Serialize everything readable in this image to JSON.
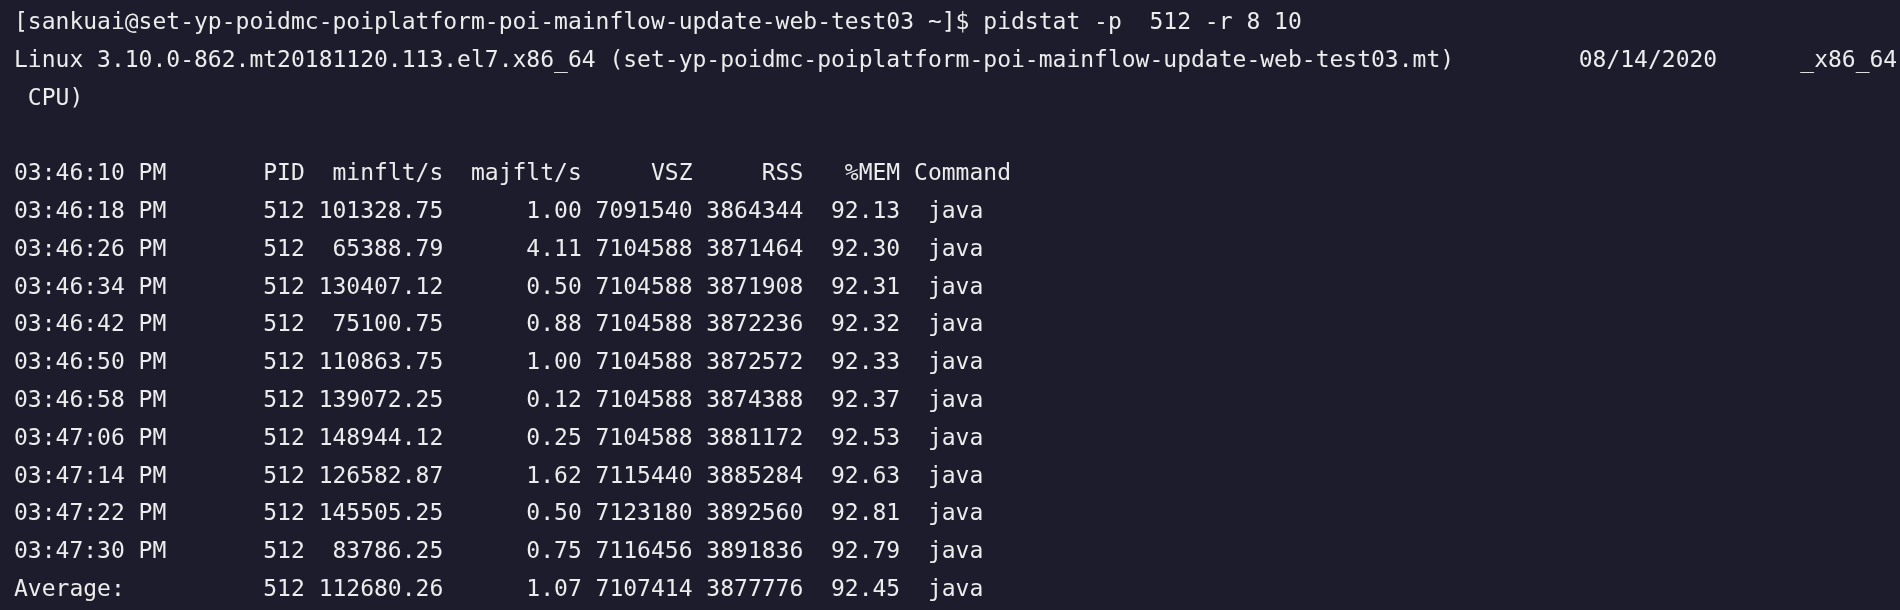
{
  "terminal": {
    "prompt": "[sankuai@set-yp-poidmc-poiplatform-poi-mainflow-update-web-test03 ~]$ pidstat -p  512 -r 8 10",
    "info_lines": [
      "Linux 3.10.0-862.mt20181120.113.el7.x86_64 (set-yp-poidmc-poiplatform-poi-mainflow-update-web-test03.mt)         08/14/2020      _x86_64",
      " CPU)"
    ],
    "table": {
      "header": "03:46:10 PM       PID  minflt/s  majflt/s     VSZ     RSS   %MEM Command",
      "rows": [
        "03:46:18 PM       512 101328.75      1.00 7091540 3864344  92.13  java",
        "03:46:26 PM       512  65388.79      4.11 7104588 3871464  92.30  java",
        "03:46:34 PM       512 130407.12      0.50 7104588 3871908  92.31  java",
        "03:46:42 PM       512  75100.75      0.88 7104588 3872236  92.32  java",
        "03:46:50 PM       512 110863.75      1.00 7104588 3872572  92.33  java",
        "03:46:58 PM       512 139072.25      0.12 7104588 3874388  92.37  java",
        "03:47:06 PM       512 148944.12      0.25 7104588 3881172  92.53  java",
        "03:47:14 PM       512 126582.87      1.62 7115440 3885284  92.63  java",
        "03:47:22 PM       512 145505.25      0.50 7123180 3892560  92.81  java",
        "03:47:30 PM       512  83786.25      0.75 7116456 3891836  92.79  java",
        "Average:          512 112680.26      1.07 7107414 3877776  92.45  java"
      ]
    }
  }
}
